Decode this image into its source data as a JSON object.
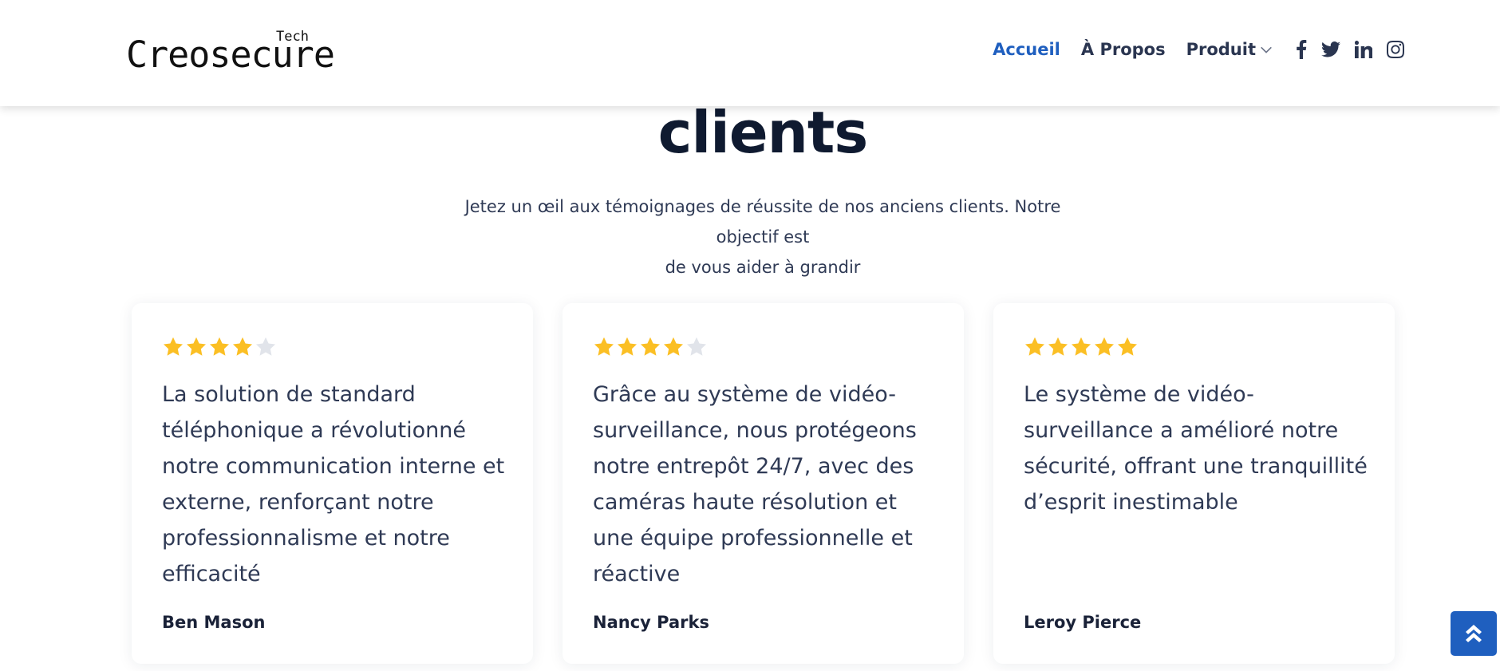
{
  "header": {
    "logo": {
      "main": "Creosecure",
      "sub": "Tech"
    },
    "nav": [
      {
        "label": "Accueil",
        "active": true
      },
      {
        "label": "À Propos",
        "active": false
      },
      {
        "label": "Produit",
        "active": false,
        "has_dropdown": true
      }
    ],
    "social_icons": [
      "facebook-icon",
      "twitter-icon",
      "linkedin-icon",
      "instagram-icon"
    ],
    "active_color": "#1f5fbf"
  },
  "section": {
    "title": "clients",
    "subtitle_line1": "Jetez un œil aux témoignages de réussite de nos anciens clients. Notre objectif est",
    "subtitle_line2": "de vous aider à grandir"
  },
  "testimonials": [
    {
      "rating": 4,
      "quote": "La solution de standard téléphonique a révolutionné notre communication interne et externe, renforçant notre professionnalisme et notre efficacité",
      "author": "Ben Mason"
    },
    {
      "rating": 4,
      "quote": "Grâce au système de vidéo-surveillance, nous protégeons notre entrepôt 24/7, avec des caméras haute résolution et une équipe professionnelle et réactive",
      "author": "Nancy Parks"
    },
    {
      "rating": 5,
      "quote": "Le système de vidéo-surveillance a amélioré notre sécurité, offrant une tranquillité d’esprit inestimable",
      "author": "Leroy Pierce"
    }
  ],
  "colors": {
    "star_on": "#fbbf24",
    "star_off": "#e1e4ea",
    "back_to_top": "#1f5fbf"
  },
  "back_to_top_icon": "double-chevron-up-icon"
}
